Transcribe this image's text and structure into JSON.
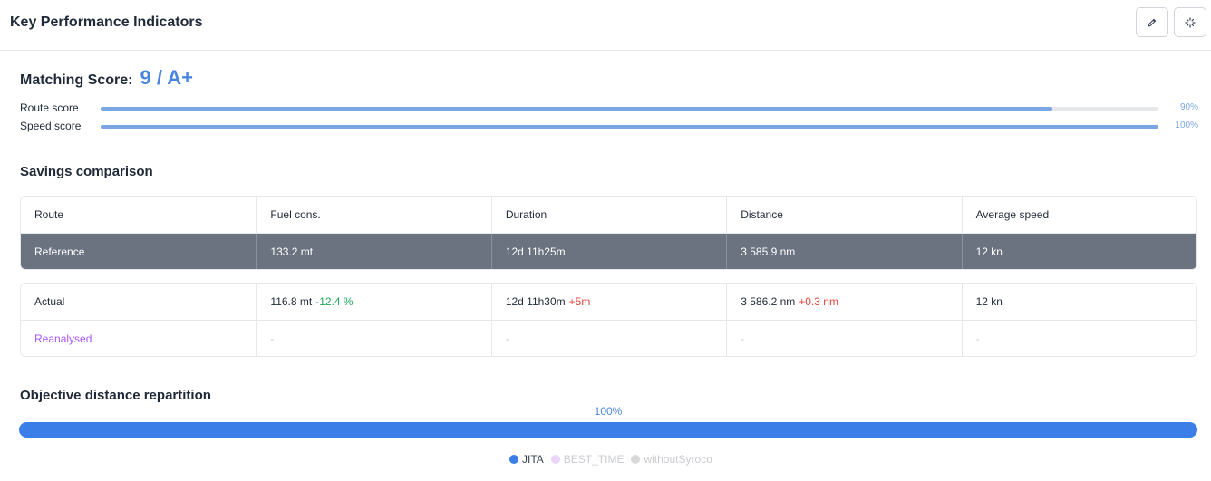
{
  "header": {
    "title": "Key Performance Indicators"
  },
  "matching": {
    "label": "Matching Score:",
    "value": "9 / A+"
  },
  "scores": [
    {
      "label": "Route score",
      "percent": 90,
      "percent_label": "90%"
    },
    {
      "label": "Speed score",
      "percent": 100,
      "percent_label": "100%"
    }
  ],
  "savings": {
    "title": "Savings comparison",
    "columns": [
      "Route",
      "Fuel cons.",
      "Duration",
      "Distance",
      "Average speed"
    ],
    "reference": [
      "Reference",
      "133.2 mt",
      "12d 11h25m",
      "3 585.9 nm",
      "12 kn"
    ],
    "actual": {
      "route": "Actual",
      "fuel": "116.8 mt",
      "fuel_delta": "-12.4 %",
      "duration": "12d 11h30m",
      "duration_delta": "+5m",
      "distance": "3 586.2 nm",
      "distance_delta": "+0.3 nm",
      "speed": "12 kn"
    },
    "reanalysed": {
      "route": "Reanalysed",
      "fuel": "-",
      "duration": "-",
      "distance": "-",
      "speed": "-"
    }
  },
  "objective": {
    "title": "Objective distance repartition",
    "percent_label": "100%",
    "share": 100,
    "legend": [
      {
        "label": "JITA",
        "color": "#3b7ee8",
        "active": true
      },
      {
        "label": "BEST_TIME",
        "color": "#e9d5f7",
        "active": false
      },
      {
        "label": "withoutSyroco",
        "color": "#d9d9d9",
        "active": false
      }
    ]
  },
  "colors": {
    "accent": "#4a86e0",
    "bar": "#3b7ee8",
    "reference_row": "#6b7280",
    "positive": "#22a55a",
    "negative": "#e0443c",
    "reanalysed": "#a855f7"
  }
}
